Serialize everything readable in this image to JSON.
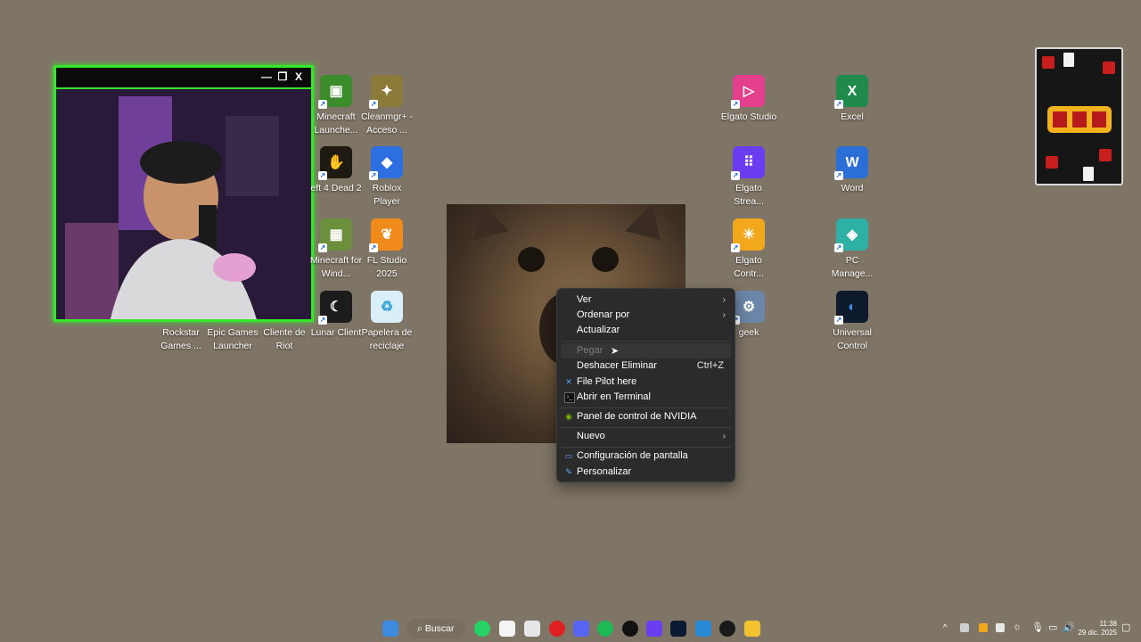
{
  "desktop_icons": [
    {
      "label": "Minecraft Launche...",
      "icon": "minecraft-launcher-icon",
      "color": "#3b8c2a"
    },
    {
      "label": "Cleanmgr+ - Acceso ...",
      "icon": "cleanmgr-icon",
      "color": "#8b7a3a"
    },
    {
      "label": "eft 4 Dead 2",
      "icon": "left-4-dead-icon",
      "color": "#1e1a12"
    },
    {
      "label": "Roblox Player",
      "icon": "roblox-icon",
      "color": "#2d6fe0"
    },
    {
      "label": "Minecraft for Wind...",
      "icon": "minecraft-windows-icon",
      "color": "#6b8f3a"
    },
    {
      "label": "FL Studio 2025",
      "icon": "fl-studio-icon",
      "color": "#f08a1a"
    },
    {
      "label": "Rockstar Games ...",
      "icon": "rockstar-icon",
      "color": "#f4b400"
    },
    {
      "label": "Epic Games Launcher",
      "icon": "epic-games-icon",
      "color": "#222222"
    },
    {
      "label": "Cliente de Riot",
      "icon": "riot-icon",
      "color": "#d13639"
    },
    {
      "label": "Lunar Client",
      "icon": "lunar-client-icon",
      "color": "#1c1c1c"
    },
    {
      "label": "Papelera de reciclaje",
      "icon": "recycle-bin-icon",
      "color": "#3aa5d8"
    },
    {
      "label": "Elgato Studio",
      "icon": "elgato-studio-icon",
      "color": "#e33f8c"
    },
    {
      "label": "Elgato Strea...",
      "icon": "elgato-stream-icon",
      "color": "#6a3df0"
    },
    {
      "label": "Elgato Contr...",
      "icon": "elgato-control-icon",
      "color": "#f2a81c"
    },
    {
      "label": "geek",
      "icon": "geek-icon",
      "color": "#6b86a8"
    },
    {
      "label": "Excel",
      "icon": "excel-icon",
      "color": "#1f8a4c"
    },
    {
      "label": "Word",
      "icon": "word-icon",
      "color": "#2b6fd6"
    },
    {
      "label": "PC Manage...",
      "icon": "pc-manager-icon",
      "color": "#2fb0a4"
    },
    {
      "label": "Universal Control",
      "icon": "universal-control-icon",
      "color": "#1a3a6a"
    }
  ],
  "webcam": {
    "buttons": [
      "—",
      "❐",
      "X"
    ],
    "frame_color": "#35e62b"
  },
  "context_menu": {
    "items": [
      {
        "label": "Ver",
        "submenu": true
      },
      {
        "label": "Ordenar por",
        "submenu": true
      },
      {
        "label": "Actualizar"
      },
      {
        "label": "Pegar",
        "disabled": true
      },
      {
        "label": "Deshacer Eliminar",
        "shortcut": "Ctrl+Z"
      },
      {
        "label": "File Pilot here",
        "icon": "file-pilot-icon"
      },
      {
        "label": "Abrir en Terminal",
        "icon": "terminal-icon"
      },
      {
        "label": "Panel de control de NVIDIA",
        "icon": "nvidia-icon"
      },
      {
        "label": "Nuevo",
        "submenu": true
      },
      {
        "label": "Configuración de pantalla",
        "icon": "display-settings-icon"
      },
      {
        "label": "Personalizar",
        "icon": "personalize-icon"
      }
    ]
  },
  "taskbar": {
    "search_label": "Buscar",
    "time": "11:38",
    "date": "29 dic. 2025"
  }
}
